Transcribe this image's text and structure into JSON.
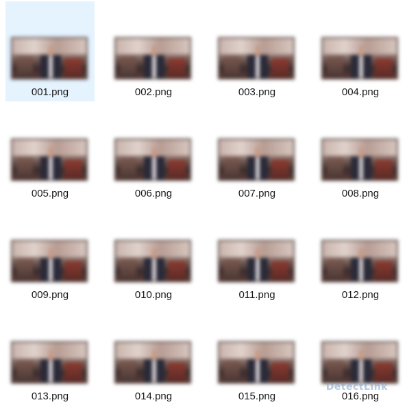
{
  "files": [
    {
      "name": "001.png",
      "selected": true
    },
    {
      "name": "002.png",
      "selected": false
    },
    {
      "name": "003.png",
      "selected": false
    },
    {
      "name": "004.png",
      "selected": false
    },
    {
      "name": "005.png",
      "selected": false
    },
    {
      "name": "006.png",
      "selected": false
    },
    {
      "name": "007.png",
      "selected": false
    },
    {
      "name": "008.png",
      "selected": false
    },
    {
      "name": "009.png",
      "selected": false
    },
    {
      "name": "010.png",
      "selected": false
    },
    {
      "name": "011.png",
      "selected": false
    },
    {
      "name": "012.png",
      "selected": false
    },
    {
      "name": "013.png",
      "selected": false
    },
    {
      "name": "014.png",
      "selected": false
    },
    {
      "name": "015.png",
      "selected": false
    },
    {
      "name": "016.png",
      "selected": false
    }
  ],
  "watermark": "DetectLink",
  "colors": {
    "selection": "#e5f3ff",
    "label": "#1a1a1a"
  }
}
